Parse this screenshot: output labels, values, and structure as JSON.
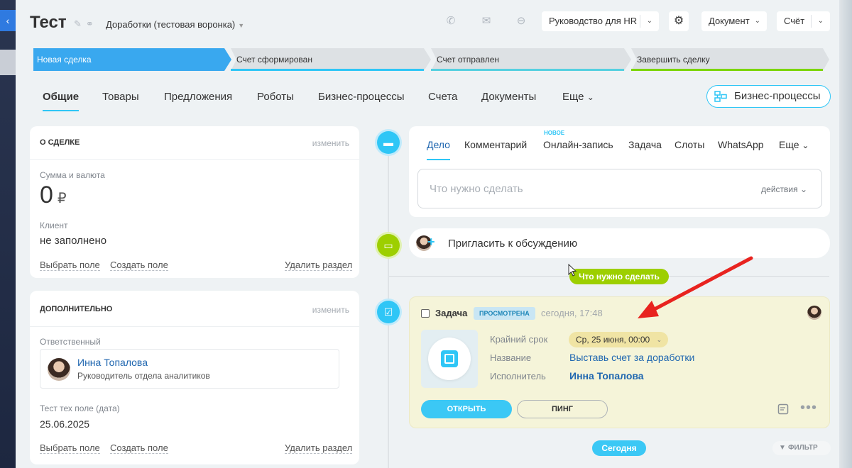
{
  "left_edge": {
    "icon": "‹"
  },
  "header": {
    "title": "Тест",
    "funnel": "Доработки (тестовая воронка)",
    "hr_guide": "Руководство для HR",
    "document": "Документ",
    "invoice": "Счёт"
  },
  "stages": [
    {
      "label": "Новая сделка",
      "color": "#39a8ef"
    },
    {
      "label": "Счет сформирован",
      "color": "#2fc6f6"
    },
    {
      "label": "Счет отправлен",
      "color": "#55d0e0"
    },
    {
      "label": "Завершить сделку",
      "color": "#7bd500"
    }
  ],
  "tabs": [
    "Общие",
    "Товары",
    "Предложения",
    "Роботы",
    "Бизнес-процессы",
    "Счета",
    "Документы",
    "Еще"
  ],
  "bp_button": "Бизнес-процессы",
  "deal_card": {
    "header": "О сделке",
    "edit": "изменить",
    "amount_label": "Сумма и валюта",
    "amount": "0",
    "currency": "₽",
    "client_label": "Клиент",
    "client_value": "не заполнено",
    "choose_field": "Выбрать поле",
    "create_field": "Создать поле",
    "delete_section": "Удалить раздел"
  },
  "extra_card": {
    "header": "Дополнительно",
    "edit": "изменить",
    "responsible_label": "Ответственный",
    "responsible_name": "Инна Топалова",
    "responsible_position": "Руководитель отдела аналитиков",
    "test_field_label": "Тест тех поле (дата)",
    "test_field_value": "25.06.2025",
    "choose_field": "Выбрать поле",
    "create_field": "Создать поле",
    "delete_section": "Удалить раздел"
  },
  "editor": {
    "tabs": [
      "Дело",
      "Комментарий",
      "Онлайн-запись",
      "Задача",
      "Слоты",
      "WhatsApp",
      "Еще"
    ],
    "new_badge": "НОВОЕ",
    "placeholder": "Что нужно сделать",
    "actions": "действия"
  },
  "invite": "Пригласить к обсуждению",
  "todo_pill": "Что нужно сделать",
  "task": {
    "title": "Задача",
    "status": "ПРОСМОТРЕНА",
    "time": "сегодня, 17:48",
    "deadline_label": "Крайний срок",
    "deadline_value": "Ср, 25 июня, 00:00",
    "name_label": "Название",
    "name_value": "Выставь счет за доработки",
    "assignee_label": "Исполнитель",
    "assignee_value": "Инна Топалова",
    "open": "ОТКРЫТЬ",
    "ping": "ПИНГ"
  },
  "today_pill": "Сегодня",
  "filter": "ФИЛЬТР",
  "accent": "#2fc6f6",
  "annotation_arrow_color": "#e8231f"
}
